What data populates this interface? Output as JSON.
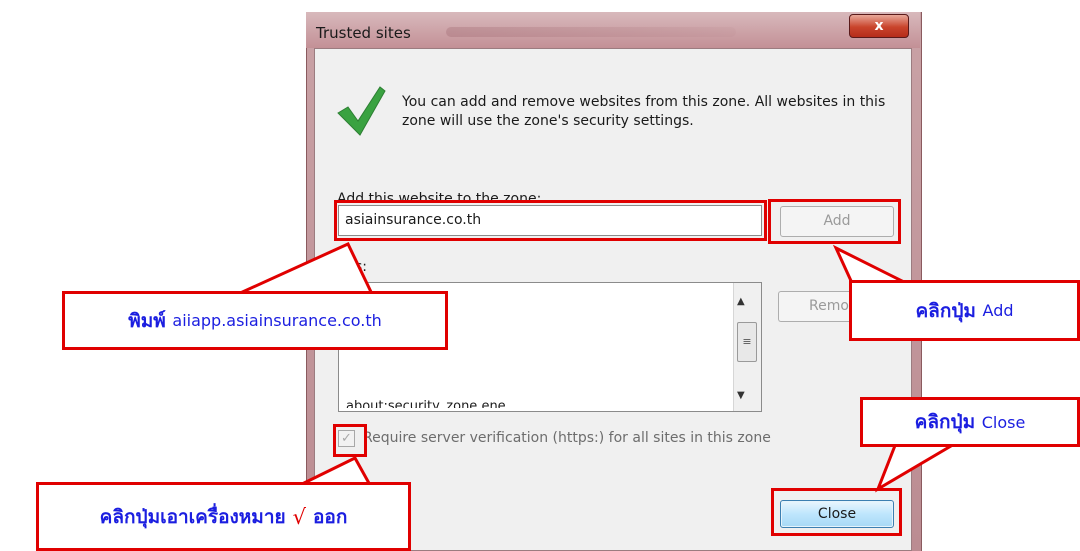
{
  "window": {
    "title": "Trusted sites",
    "close_glyph": "x"
  },
  "dialog": {
    "info_text": "You can add and remove websites from this zone. All websites in this zone will use the zone's security settings.",
    "add_label": "Add this website to the zone:",
    "url_value": "asiainsurance.co.th",
    "add_button": "Add",
    "sites_label": "ites:",
    "sites_list": [
      "about:security_zone.ene"
    ],
    "remove_button": "Remov",
    "require_https_checked": true,
    "require_https_label": "Require server verification (https:) for all sites in this zone",
    "close_button": "Close"
  },
  "callouts": {
    "type_bold": "พิมพ์",
    "type_url": "aiiapp.asiainsurance.co.th",
    "add_bold": "คลิกปุ่ม",
    "add_tail": "Add",
    "close_bold": "คลิกปุ่ม",
    "close_tail": "Close",
    "uncheck_bold1": "คลิกปุ่มเอาเครื่องหมาย",
    "uncheck_mark": "√",
    "uncheck_bold2": "ออก"
  },
  "icons": {
    "checkmark": "check-icon",
    "close": "close-icon"
  },
  "colors": {
    "highlight": "#e00000",
    "callout_text": "#1b1ee0",
    "check_green": "#3aa241"
  }
}
